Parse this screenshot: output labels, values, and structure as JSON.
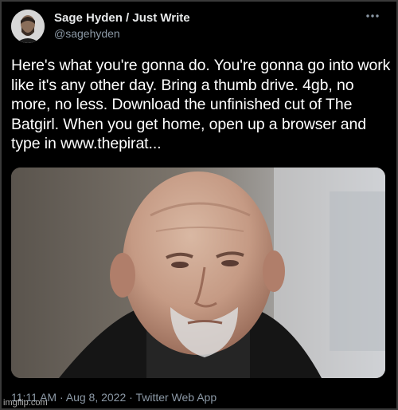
{
  "tweet": {
    "author_name": "Sage Hyden / Just Write",
    "author_handle": "@sagehyden",
    "text": "Here's what you're gonna do. You're gonna go into work like it's any other day. Bring a thumb drive. 4gb, no more, no less. Download the unfinished cut of The Batgirl. When you get home, open up a browser and type in www.thepirat...",
    "timestamp": "11:11 AM · Aug 8, 2022 · Twitter Web App",
    "more_icon": "more-dots-icon"
  },
  "watermark": "imgflip.com",
  "colors": {
    "background": "#000000",
    "primary_text": "#e7e9ea",
    "secondary_text": "#8b98a5"
  }
}
